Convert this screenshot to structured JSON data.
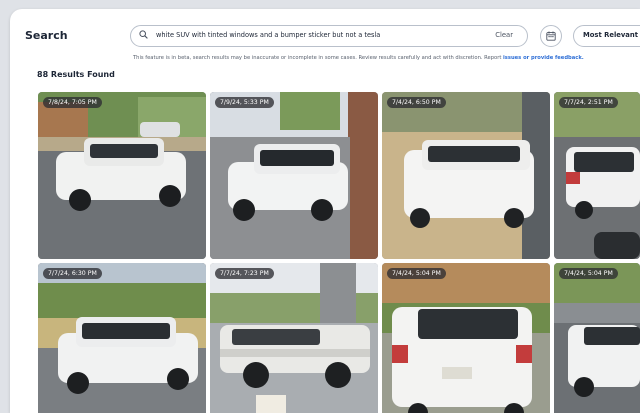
{
  "header": {
    "title": "Search",
    "search_query": "white SUV with tinted windows and a bumper sticker but not a tesla",
    "clear_label": "Clear",
    "sort_label": "Most Relevant"
  },
  "notice": {
    "text": "This feature is in beta, search results may be inaccurate or incomplete in some cases. Review results carefully and act with discretion. Report ",
    "link": "issues or provide feedback."
  },
  "results": {
    "count_label": "88 Results Found",
    "timestamps": [
      "7/8/24, 7:05 PM",
      "7/9/24, 5:33 PM",
      "7/4/24, 6:50 PM",
      "7/7/24, 2:51 PM",
      "7/7/24, 6:30 PM",
      "7/7/24, 7:23 PM",
      "7/4/24, 5:04 PM",
      "7/4/24, 5:04 PM"
    ]
  },
  "colors": {
    "accent": "#2f6fd6",
    "text": "#1d2636",
    "border": "#b9c0cb"
  }
}
